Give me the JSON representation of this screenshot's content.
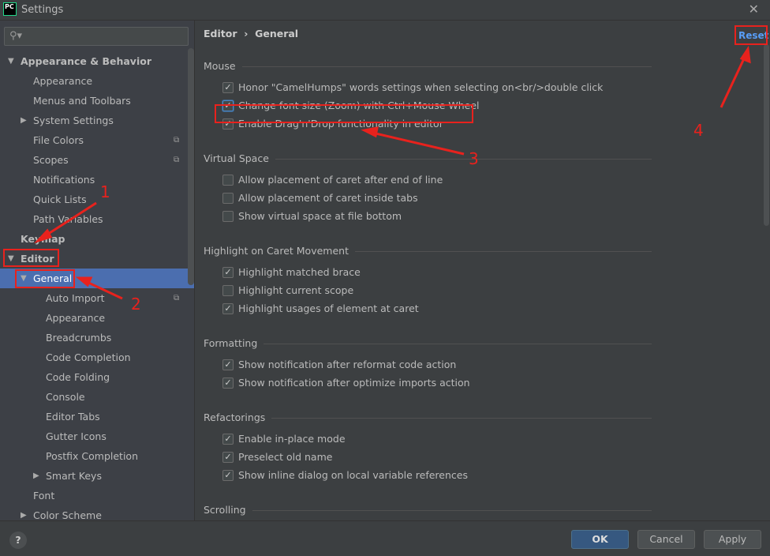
{
  "window": {
    "title": "Settings",
    "logo": "PC",
    "close_icon": "close-icon"
  },
  "sidebar": {
    "search_placeholder": "",
    "items": [
      {
        "label": "Appearance & Behavior",
        "level": 0,
        "arrow": "expanded",
        "bold": true
      },
      {
        "label": "Appearance",
        "level": 1
      },
      {
        "label": "Menus and Toolbars",
        "level": 1
      },
      {
        "label": "System Settings",
        "level": 1,
        "arrow": "collapsed"
      },
      {
        "label": "File Colors",
        "level": 1,
        "copy": true
      },
      {
        "label": "Scopes",
        "level": 1,
        "copy": true
      },
      {
        "label": "Notifications",
        "level": 1
      },
      {
        "label": "Quick Lists",
        "level": 1
      },
      {
        "label": "Path Variables",
        "level": 1
      },
      {
        "label": "Keymap",
        "level": 0,
        "bold": true
      },
      {
        "label": "Editor",
        "level": 0,
        "arrow": "expanded",
        "bold": true
      },
      {
        "label": "General",
        "level": 1,
        "arrow": "expanded",
        "selected": true
      },
      {
        "label": "Auto Import",
        "level": 2,
        "copy": true
      },
      {
        "label": "Appearance",
        "level": 2
      },
      {
        "label": "Breadcrumbs",
        "level": 2
      },
      {
        "label": "Code Completion",
        "level": 2
      },
      {
        "label": "Code Folding",
        "level": 2
      },
      {
        "label": "Console",
        "level": 2
      },
      {
        "label": "Editor Tabs",
        "level": 2
      },
      {
        "label": "Gutter Icons",
        "level": 2
      },
      {
        "label": "Postfix Completion",
        "level": 2
      },
      {
        "label": "Smart Keys",
        "level": 2,
        "arrow": "collapsed"
      },
      {
        "label": "Font",
        "level": 1
      },
      {
        "label": "Color Scheme",
        "level": 1,
        "arrow": "collapsed"
      }
    ]
  },
  "main": {
    "breadcrumb": [
      "Editor",
      "General"
    ],
    "breadcrumb_sep": "›",
    "reset_label": "Reset",
    "sections": [
      {
        "title": "Mouse",
        "options": [
          {
            "label": "Honor \"CamelHumps\" words settings when selecting on<br/>double click",
            "checked": true
          },
          {
            "label": "Change font size (Zoom) with Ctrl+Mouse Wheel",
            "checked": true,
            "focused": true
          },
          {
            "label": "Enable Drag'n'Drop functionality in editor",
            "checked": true
          }
        ]
      },
      {
        "title": "Virtual Space",
        "options": [
          {
            "label": "Allow placement of caret after end of line",
            "checked": false
          },
          {
            "label": "Allow placement of caret inside tabs",
            "checked": false
          },
          {
            "label": "Show virtual space at file bottom",
            "checked": false
          }
        ]
      },
      {
        "title": "Highlight on Caret Movement",
        "options": [
          {
            "label": "Highlight matched brace",
            "checked": true
          },
          {
            "label": "Highlight current scope",
            "checked": false
          },
          {
            "label": "Highlight usages of element at caret",
            "checked": true
          }
        ]
      },
      {
        "title": "Formatting",
        "options": [
          {
            "label": "Show notification after reformat code action",
            "checked": true
          },
          {
            "label": "Show notification after optimize imports action",
            "checked": true
          }
        ]
      },
      {
        "title": "Refactorings",
        "options": [
          {
            "label": "Enable in-place mode",
            "checked": true
          },
          {
            "label": "Preselect old name",
            "checked": true
          },
          {
            "label": "Show inline dialog on local variable references",
            "checked": true
          }
        ]
      },
      {
        "title": "Scrolling",
        "options": []
      }
    ]
  },
  "footer": {
    "help": "?",
    "ok": "OK",
    "cancel": "Cancel",
    "apply": "Apply"
  },
  "annotations": {
    "color": "#e8221d",
    "labels": [
      "1",
      "2",
      "3",
      "4"
    ]
  }
}
